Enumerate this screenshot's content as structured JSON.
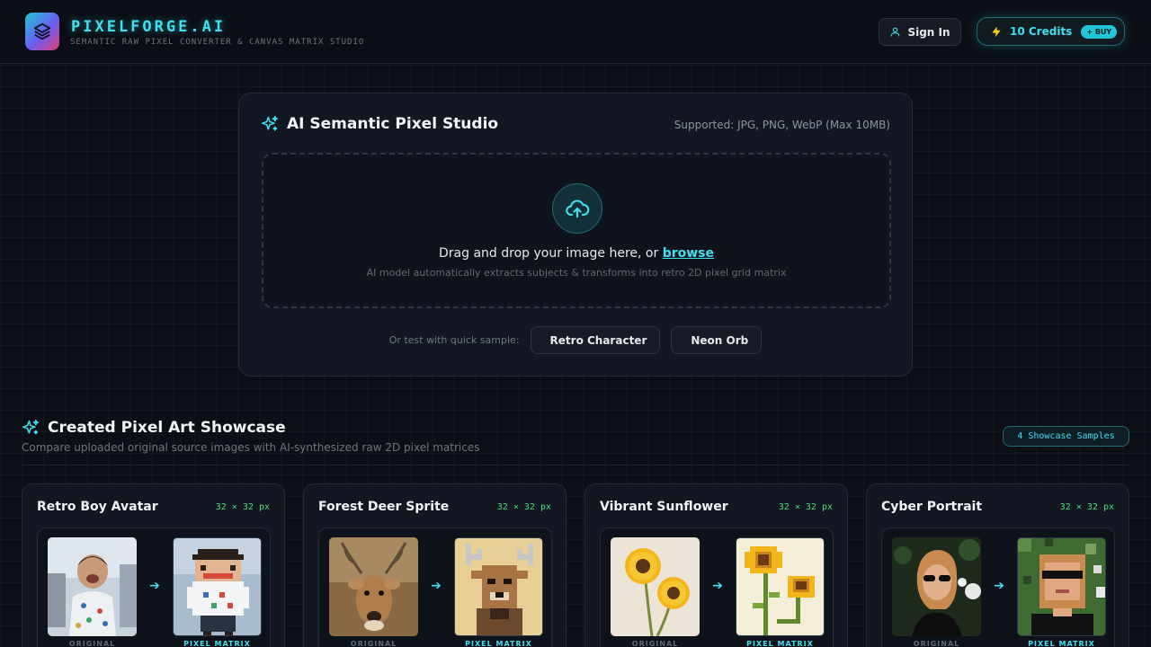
{
  "header": {
    "brand_name": "PIXELFORGE.AI",
    "brand_subtitle": "SEMANTIC RAW PIXEL CONVERTER & CANVAS MATRIX STUDIO",
    "sign_in_label": "Sign In",
    "credits_label": "10 Credits",
    "buy_label": "+ BUY"
  },
  "studio": {
    "title": "AI Semantic Pixel Studio",
    "supported": "Supported: JPG, PNG, WebP (Max 10MB)",
    "drop_text": "Drag and drop your image here, or",
    "browse_link": "browse",
    "drop_subtext": "AI model automatically extracts subjects & transforms into retro 2D pixel grid matrix",
    "sample_label": "Or test with quick sample:",
    "samples": [
      "Retro Character",
      "Neon Orb"
    ]
  },
  "showcase": {
    "title": "Created Pixel Art Showcase",
    "subtitle": "Compare uploaded original source images with AI-synthesized raw 2D pixel matrices",
    "badge": "4 Showcase Samples",
    "original_caption": "ORIGINAL",
    "pixel_caption": "PIXEL MATRIX",
    "cards": [
      {
        "title": "Retro Boy Avatar",
        "size": "32 × 32 px"
      },
      {
        "title": "Forest Deer Sprite",
        "size": "32 × 32 px"
      },
      {
        "title": "Vibrant Sunflower",
        "size": "32 × 32 px"
      },
      {
        "title": "Cyber Portrait",
        "size": "32 × 32 px"
      }
    ]
  },
  "colors": {
    "accent": "#3fe0ef",
    "success": "#4ade80",
    "background": "#0c0f15",
    "card": "#121722"
  },
  "icons": {
    "logo": "layers-icon",
    "sign_in": "user-icon",
    "credits": "lightning-icon",
    "studio": "sparkle-icon",
    "upload": "cloud-upload-icon",
    "arrow": "arrow-right-icon"
  }
}
